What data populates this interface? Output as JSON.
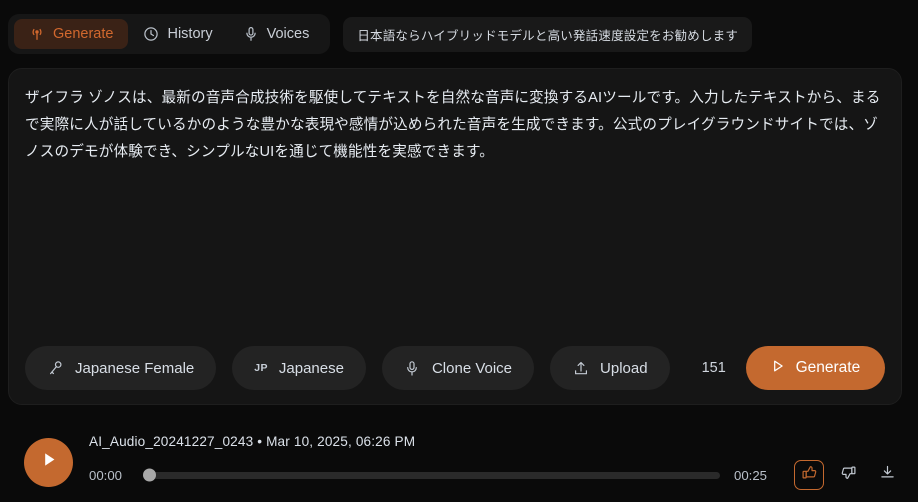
{
  "tabs": [
    {
      "label": "Generate",
      "icon": "broadcast-icon",
      "active": true
    },
    {
      "label": "History",
      "icon": "clock-icon",
      "active": false
    },
    {
      "label": "Voices",
      "icon": "microphone-icon",
      "active": false
    }
  ],
  "notice": {
    "text": "日本語ならハイブリッドモデルと高い発話速度設定をお勧めします"
  },
  "editor": {
    "text": "ザイフラ ゾノスは、最新の音声合成技術を駆使してテキストを自然な音声に変換するAIツールです。入力したテキストから、まるで実際に人が話しているかのような豊かな表現や感情が込められた音声を生成できます。公式のプレイグラウンドサイトでは、ゾノスのデモが体験でき、シンプルなUIを通じて機能性を実感できます。",
    "placeholder": ""
  },
  "toolbar": {
    "voice_label": "Japanese Female",
    "voice_icon": "stage-microphone-icon",
    "language_badge": "JP",
    "language_label": "Japanese",
    "clone_label": "Clone Voice",
    "clone_icon": "microphone-icon",
    "upload_label": "Upload",
    "upload_icon": "upload-icon",
    "char_count": "151",
    "generate_label": "Generate",
    "generate_icon": "play-triangle-icon"
  },
  "player": {
    "title": "AI_Audio_20241227_0243 • Mar 10, 2025, 06:26 PM",
    "current_time": "00:00",
    "total_time": "00:25",
    "progress_percent": 0,
    "play_icon": "play-icon",
    "like_icon": "thumbs-up-icon",
    "dislike_icon": "thumbs-down-icon",
    "download_icon": "download-icon",
    "like_active": true
  },
  "colors": {
    "accent": "#c4692f",
    "accent_text": "#d2682e",
    "active_tab_bg": "#3a2216",
    "page_bg": "#0a0a0a",
    "card_bg": "#151515",
    "pill_bg": "#232323"
  }
}
